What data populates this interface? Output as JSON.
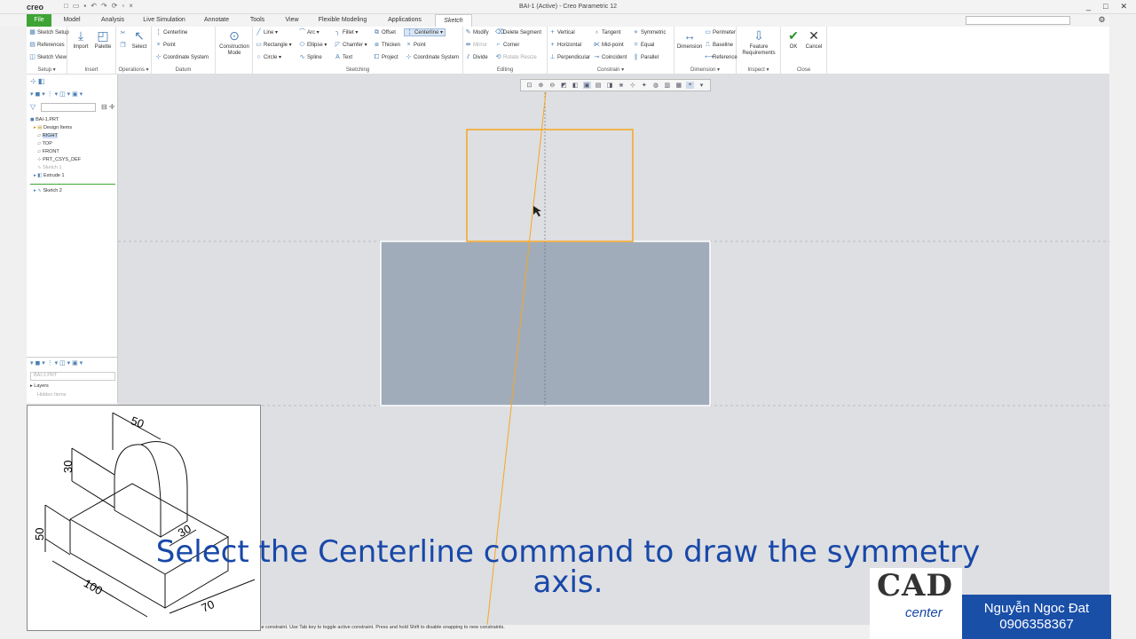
{
  "window": {
    "app_logo": "creo",
    "title": "BAI-1 (Active) - Creo Parametric 12",
    "controls": [
      "_",
      "□",
      "✕"
    ]
  },
  "tabs": [
    "File",
    "Model",
    "Analysis",
    "Live Simulation",
    "Annotate",
    "Tools",
    "View",
    "Flexible Modeling",
    "Applications",
    "Sketch"
  ],
  "active_tab": "Sketch",
  "ribbon": {
    "setup": {
      "items": [
        "Sketch Setup",
        "References",
        "Sketch View"
      ],
      "label": "Setup ▾"
    },
    "insert": {
      "items": [
        "Import",
        "Palette"
      ],
      "label": "Insert"
    },
    "operations": {
      "items": [
        "Select"
      ],
      "label": "Operations ▾"
    },
    "datum": {
      "items": [
        "Centerline",
        "Point",
        "Coordinate System"
      ],
      "label": "Datum"
    },
    "construction": {
      "label": "Construction Mode"
    },
    "sketching": {
      "col1": [
        "Line ▾",
        "Rectangle ▾",
        "Circle ▾"
      ],
      "col2": [
        "Arc ▾",
        "Ellipse ▾",
        "Spline"
      ],
      "col3": [
        "Fillet ▾",
        "Chamfer ▾",
        "Text"
      ],
      "col4": [
        "Offset",
        "Thicken",
        "Project"
      ],
      "col5": [
        "Centerline ▾",
        "Point",
        "Coordinate System"
      ],
      "label": "Sketching"
    },
    "editing": {
      "col1": [
        "Modify",
        "Mirror",
        "Divide"
      ],
      "col2": [
        "Delete Segment",
        "Corner",
        "Rotate Resize"
      ],
      "label": "Editing"
    },
    "constrain": {
      "col1": [
        "Vertical",
        "Horizontal",
        "Perpendicular"
      ],
      "col2": [
        "Tangent",
        "Mid-point",
        "Coincident"
      ],
      "col3": [
        "Symmetric",
        "Equal",
        "Parallel"
      ],
      "label": "Constrain ▾"
    },
    "dimension": {
      "big": "Dimension",
      "items": [
        "Perimeter",
        "Baseline",
        "Reference"
      ],
      "label": "Dimension ▾"
    },
    "inspect": {
      "big": "Feature Requirements",
      "label": "Inspect ▾"
    },
    "close": {
      "ok": "OK",
      "cancel": "Cancel",
      "label": "Close"
    }
  },
  "tree": {
    "items": [
      "BAI-1.PRT",
      "Design Items",
      "RIGHT",
      "TOP",
      "FRONT",
      "PRT_CSYS_DEF",
      "Sketch 1",
      "Extrude 1",
      "Sketch 2"
    ],
    "layer_part": "BAI-1.PRT",
    "layers": "Layers",
    "hidden_items": "Hidden Items"
  },
  "status_text": "the constraint. Use Tab key to toggle active constraint. Press and hold Shift to disable snapping to new constraints.",
  "reference_drawing": {
    "dims": [
      "50",
      "30",
      "50",
      "30",
      "100",
      "70"
    ]
  },
  "caption": "Select the Centerline command to draw the symmetry axis.",
  "branding": {
    "logo_text": "CAD",
    "logo_sub": "center",
    "author": "Nguyễn Ngoc Đat",
    "phone": "0906358367"
  },
  "colors": {
    "file_tab": "#3ea435",
    "sketch_highlight": "#f5a623",
    "solid_fill": "#a0acba",
    "caption": "#1848a8"
  }
}
